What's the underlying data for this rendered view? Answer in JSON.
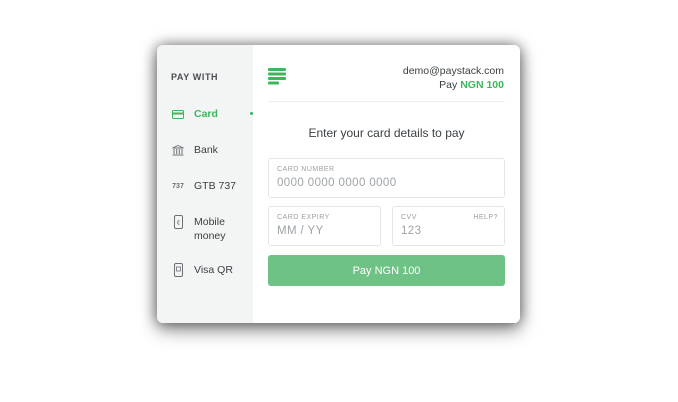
{
  "sidebar": {
    "heading": "PAY WITH",
    "items": [
      {
        "label": "Card",
        "icon": "card-icon"
      },
      {
        "label": "Bank",
        "icon": "bank-icon"
      },
      {
        "label": "GTB 737",
        "icon": "ussd-icon",
        "icon_text": "737"
      },
      {
        "label": "Mobile money",
        "icon": "mobile-money-icon"
      },
      {
        "label": "Visa QR",
        "icon": "qr-phone-icon"
      }
    ]
  },
  "header": {
    "email": "demo@paystack.com",
    "pay_label": "Pay",
    "amount": "NGN 100"
  },
  "form": {
    "instruction": "Enter your card details to pay",
    "card_number": {
      "label": "CARD NUMBER",
      "placeholder": "0000 0000 0000 0000"
    },
    "expiry": {
      "label": "CARD EXPIRY",
      "placeholder": "MM / YY"
    },
    "cvv": {
      "label": "CVV",
      "placeholder": "123",
      "help": "HELP?"
    },
    "pay_button": "Pay NGN 100"
  },
  "colors": {
    "accent": "#3bb75e",
    "button": "#6ec286",
    "sidebar_bg": "#f3f4f4"
  }
}
